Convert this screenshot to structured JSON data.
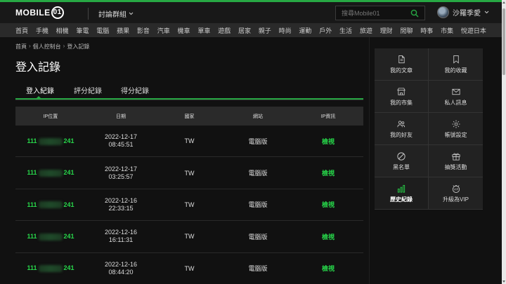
{
  "header": {
    "logo_text": "MOBILE",
    "logo_mark": "01",
    "forum_menu": "討論群組",
    "search_placeholder": "搜尋Mobile01",
    "username": "沙羅季愛"
  },
  "nav": [
    "首頁",
    "手機",
    "相機",
    "筆電",
    "電腦",
    "蘋果",
    "影音",
    "汽車",
    "機車",
    "單車",
    "遊戲",
    "居家",
    "親子",
    "時尚",
    "運動",
    "戶外",
    "生活",
    "旅遊",
    "理財",
    "閒聊",
    "時事",
    "市集",
    "悅遊日本"
  ],
  "breadcrumb": [
    "首頁",
    "個人控制台",
    "登入記錄"
  ],
  "page_title": "登入記錄",
  "tabs": [
    "登入紀錄",
    "評分紀錄",
    "得分紀錄"
  ],
  "table": {
    "headers": [
      "IP位置",
      "日期",
      "國家",
      "網站",
      "IP資訊"
    ],
    "rows": [
      {
        "ip_prefix": "111",
        "ip_suffix": "241",
        "date": "2022-12-17",
        "time": "08:45:51",
        "country": "TW",
        "site": "電腦版",
        "info": "檢視"
      },
      {
        "ip_prefix": "111",
        "ip_suffix": "241",
        "date": "2022-12-17",
        "time": "03:25:57",
        "country": "TW",
        "site": "電腦版",
        "info": "檢視"
      },
      {
        "ip_prefix": "111",
        "ip_suffix": "241",
        "date": "2022-12-16",
        "time": "22:33:15",
        "country": "TW",
        "site": "電腦版",
        "info": "檢視"
      },
      {
        "ip_prefix": "111",
        "ip_suffix": "241",
        "date": "2022-12-16",
        "time": "16:11:31",
        "country": "TW",
        "site": "電腦版",
        "info": "檢視"
      },
      {
        "ip_prefix": "111",
        "ip_suffix": "241",
        "date": "2022-12-16",
        "time": "08:44:20",
        "country": "TW",
        "site": "電腦版",
        "info": "檢視"
      }
    ]
  },
  "sidebar": [
    {
      "label": "我的文章",
      "icon": "document-icon"
    },
    {
      "label": "我的收藏",
      "icon": "bookmark-icon"
    },
    {
      "label": "我的市集",
      "icon": "store-icon"
    },
    {
      "label": "私人訊息",
      "icon": "mail-icon"
    },
    {
      "label": "我的好友",
      "icon": "friends-icon"
    },
    {
      "label": "帳號設定",
      "icon": "gear-icon"
    },
    {
      "label": "黑名單",
      "icon": "block-icon"
    },
    {
      "label": "抽獎活動",
      "icon": "gift-icon"
    },
    {
      "label": "歷史紀錄",
      "icon": "history-chart-icon",
      "active": true
    },
    {
      "label": "升級為VIP",
      "icon": "vip-icon"
    }
  ],
  "colors": {
    "accent": "#27a844",
    "link": "#27d84a",
    "background": "#111111"
  }
}
